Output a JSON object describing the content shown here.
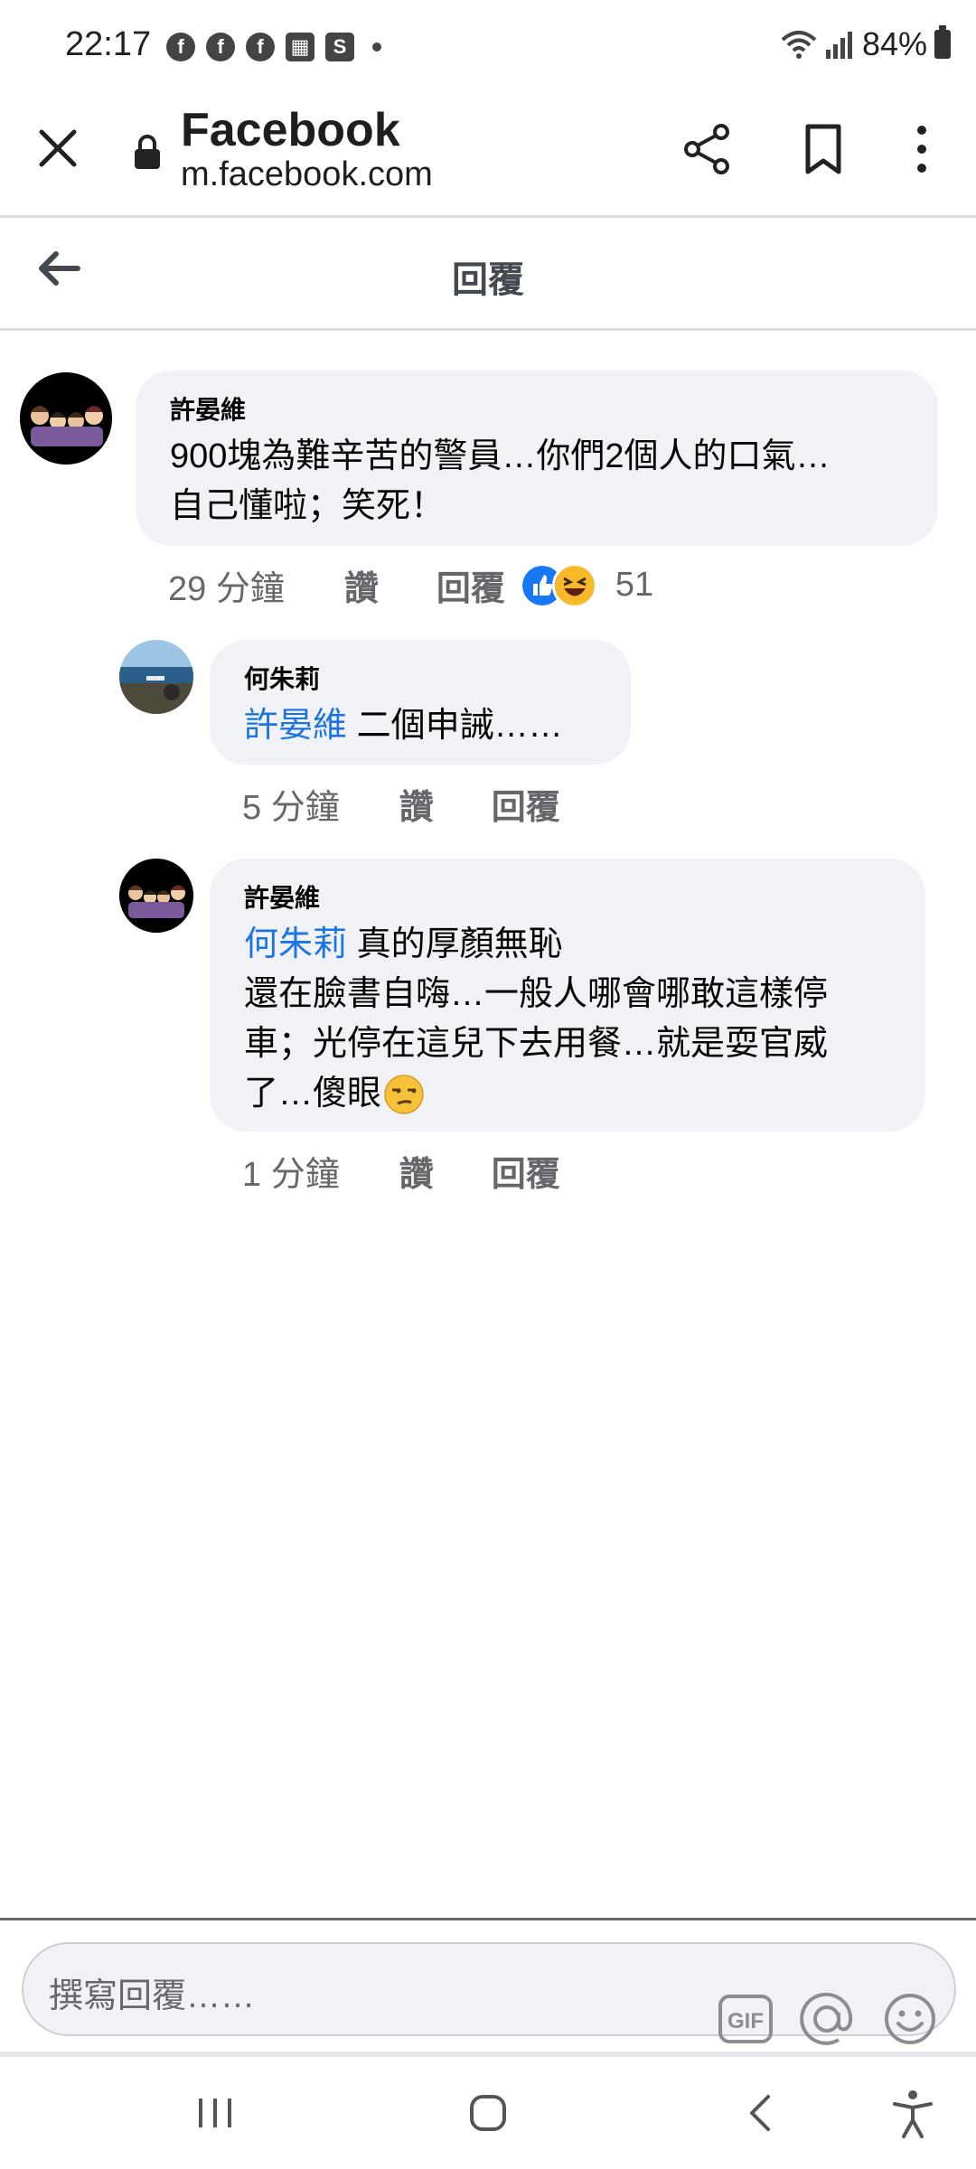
{
  "status_bar": {
    "time": "22:17",
    "battery": "84%"
  },
  "browser": {
    "title": "Facebook",
    "url": "m.facebook.com"
  },
  "header": {
    "title": "回覆"
  },
  "comments": [
    {
      "author": "許晏維",
      "text_lines": [
        "900塊為難辛苦的警員…你們2個人的口氣…",
        "自己懂啦；笑死！"
      ],
      "time": "29 分鐘",
      "like_label": "讚",
      "reply_label": "回覆",
      "reactions": [
        "like-icon",
        "haha-icon"
      ],
      "reaction_count": "51"
    },
    {
      "author": "何朱莉",
      "mention": "許晏維",
      "text": " 二個申誡……",
      "time": "5 分鐘",
      "like_label": "讚",
      "reply_label": "回覆"
    },
    {
      "author": "許晏維",
      "mention": "何朱莉",
      "first_line": " 真的厚顏無恥",
      "text_lines": [
        "還在臉書自嗨…一般人哪會哪敢這樣停",
        "車；光停在這兒下去用餐…就是耍官威",
        "了…傻眼"
      ],
      "emoji": "unamused-face-icon",
      "time": "1 分鐘",
      "like_label": "讚",
      "reply_label": "回覆"
    }
  ],
  "composer": {
    "placeholder": "撰寫回覆……",
    "gif_label": "GIF"
  },
  "colors": {
    "link": "#1b74e4",
    "bubble": "#f0f2f5",
    "secondary_text": "#65676b"
  }
}
